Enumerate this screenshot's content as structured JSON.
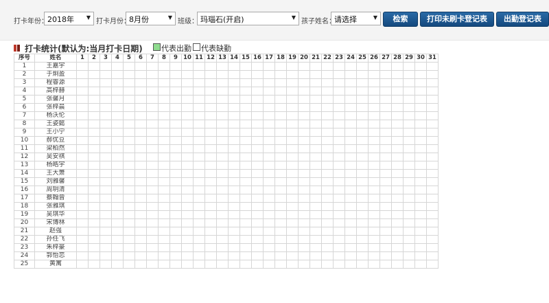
{
  "filters": {
    "year": {
      "label": "打卡年份：",
      "value": "2018年"
    },
    "month": {
      "label": "打卡月份：",
      "value": "8月份"
    },
    "class": {
      "label": "班级：",
      "value": "玛瑙石(开启)"
    },
    "child": {
      "label": "孩子姓名：",
      "value": "请选择"
    }
  },
  "buttons": {
    "search": "检索",
    "print_unswiped": "打印未刷卡登记表",
    "attendance_register": "出勤登记表"
  },
  "section": {
    "title": "打卡统计(默认为:当月打卡日期)",
    "legend_present": "代表出勤",
    "legend_absent": "代表缺勤"
  },
  "colors": {
    "present": "#8fdc8f",
    "absent": "#ffffff",
    "button": "#1a5590"
  },
  "table": {
    "headers": {
      "index": "序号",
      "name": "姓名"
    },
    "days": [
      "1",
      "2",
      "3",
      "4",
      "5",
      "6",
      "7",
      "8",
      "9",
      "10",
      "11",
      "12",
      "13",
      "14",
      "15",
      "16",
      "17",
      "18",
      "19",
      "20",
      "21",
      "22",
      "23",
      "24",
      "25",
      "26",
      "27",
      "28",
      "29",
      "30",
      "31"
    ],
    "rows": [
      {
        "index": "1",
        "name": "王嘉宇"
      },
      {
        "index": "2",
        "name": "于炯盈"
      },
      {
        "index": "3",
        "name": "程睿源"
      },
      {
        "index": "4",
        "name": "高梓赫"
      },
      {
        "index": "5",
        "name": "张馨月"
      },
      {
        "index": "6",
        "name": "张梓晨"
      },
      {
        "index": "7",
        "name": "杨沃伦"
      },
      {
        "index": "8",
        "name": "王姿懿"
      },
      {
        "index": "9",
        "name": "王小宁"
      },
      {
        "index": "10",
        "name": "郝优豆"
      },
      {
        "index": "11",
        "name": "梁柏然"
      },
      {
        "index": "12",
        "name": "吴安祺"
      },
      {
        "index": "13",
        "name": "杨皓宇"
      },
      {
        "index": "14",
        "name": "王大箫"
      },
      {
        "index": "15",
        "name": "刘雅馨"
      },
      {
        "index": "16",
        "name": "周玥清"
      },
      {
        "index": "17",
        "name": "蔡翰曾"
      },
      {
        "index": "18",
        "name": "张雅琪"
      },
      {
        "index": "19",
        "name": "吴琪华"
      },
      {
        "index": "20",
        "name": "宋博林"
      },
      {
        "index": "21",
        "name": "赵强"
      },
      {
        "index": "22",
        "name": "孙任飞"
      },
      {
        "index": "23",
        "name": "朱梓豪"
      },
      {
        "index": "24",
        "name": "郭怡恋"
      },
      {
        "index": "25",
        "name": "黄寓"
      }
    ]
  }
}
